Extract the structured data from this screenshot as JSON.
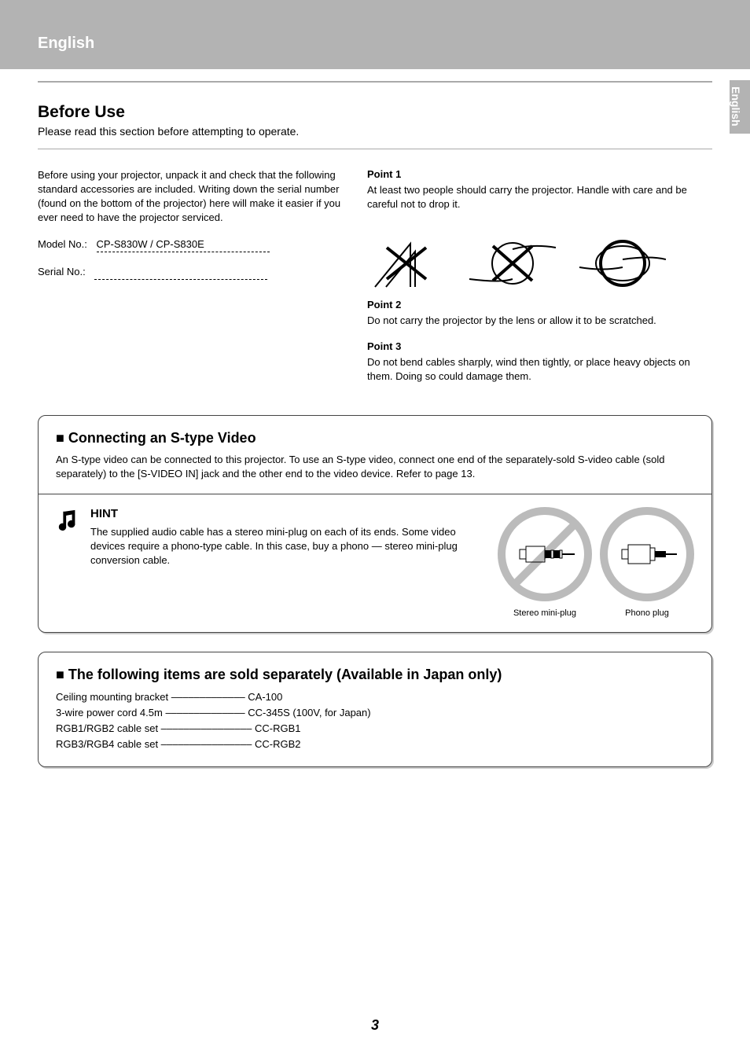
{
  "header": {
    "tab": "English",
    "side_tab": "English"
  },
  "section": {
    "title": "Before Use",
    "subtitle": "Please read this section before attempting to operate."
  },
  "col1": {
    "p1": "Before using your projector, unpack it and check that the following standard accessories are included. Writing down the serial number (found on the bottom of the projector) here will make it easier if you ever need to have the projector serviced.",
    "model_label": "Model No.:",
    "model_value": "CP-S830W / CP-S830E",
    "serial_label": "Serial No.:"
  },
  "points": {
    "t1": "Point 1",
    "p1": "At least two people should carry the projector. Handle with care and be careful not to drop it.",
    "t2": "Point 2",
    "p2": "Do not carry the projector by the lens or allow it to be scratched.",
    "t3": "Point 3",
    "p3": "Do not bend cables sharply, wind then tightly, or place heavy objects on them. Doing so could damage them."
  },
  "box1": {
    "title": "■ Connecting an S-type Video",
    "text": "An S-type video can be connected to this projector. To use an S-type video, connect one end of the separately-sold S-video cable (sold separately) to the [S-VIDEO IN] jack and the other end to the video device. Refer to page 13.",
    "hint_title": "HINT",
    "hint_body": "The supplied audio cable has a stereo mini-plug on each of its ends. Some video devices require a phono-type cable. In this case, buy a phono — stereo mini-plug conversion cable.",
    "fig_a": "Stereo mini-plug",
    "fig_b": "Phono plug"
  },
  "box2": {
    "title": "■ The following items are sold separately (Available in Japan only)",
    "l1": "Ceiling mounting bracket –––––––––––––  CA-100",
    "l2": "3-wire power cord 4.5m  ––––––––––––––  CC-345S (100V, for Japan)",
    "l3": "RGB1/RGB2 cable set  ––––––––––––––––  CC-RGB1",
    "l4": "RGB3/RGB4 cable set  ––––––––––––––––  CC-RGB2"
  },
  "footer": {
    "page": "3"
  }
}
